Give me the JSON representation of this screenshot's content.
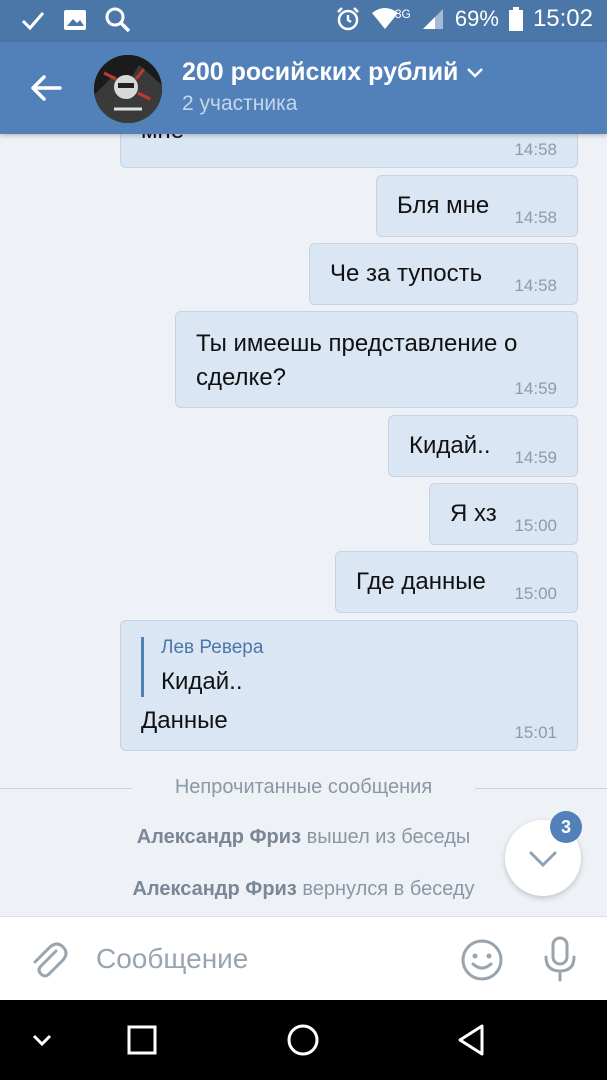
{
  "status_bar": {
    "network": "3G",
    "battery": "69%",
    "time": "15:02"
  },
  "header": {
    "title": "200 росийских рублий",
    "subtitle": "2 участника"
  },
  "messages": [
    {
      "text": "мне",
      "time": "14:58"
    },
    {
      "text": "Бля мне",
      "time": "14:58"
    },
    {
      "text": "Че за тупость",
      "time": "14:58"
    },
    {
      "text_line1": "Ты имеешь представление о",
      "text_line2": "сделке?",
      "time": "14:59"
    },
    {
      "text": "Кидай..",
      "time": "14:59"
    },
    {
      "text": "Я хз",
      "time": "15:00"
    },
    {
      "text": "Где данные",
      "time": "15:00"
    },
    {
      "reply_author": "Лев Ревера",
      "reply_text": "Кидай..",
      "text": "Данные",
      "time": "15:01"
    }
  ],
  "unread_divider": "Непрочитанные сообщения",
  "service_messages": [
    {
      "name": "Александр Фриз",
      "action": "вышел из беседы"
    },
    {
      "name": "Александр Фриз",
      "action": "вернулся в беседу"
    }
  ],
  "scroll_badge": "3",
  "input": {
    "placeholder": "Сообщение",
    "value": ""
  },
  "colors": {
    "header": "#5181b8",
    "status_bar": "#4a76a8",
    "bubble": "#dbe6f5",
    "background": "#eef1f6"
  }
}
